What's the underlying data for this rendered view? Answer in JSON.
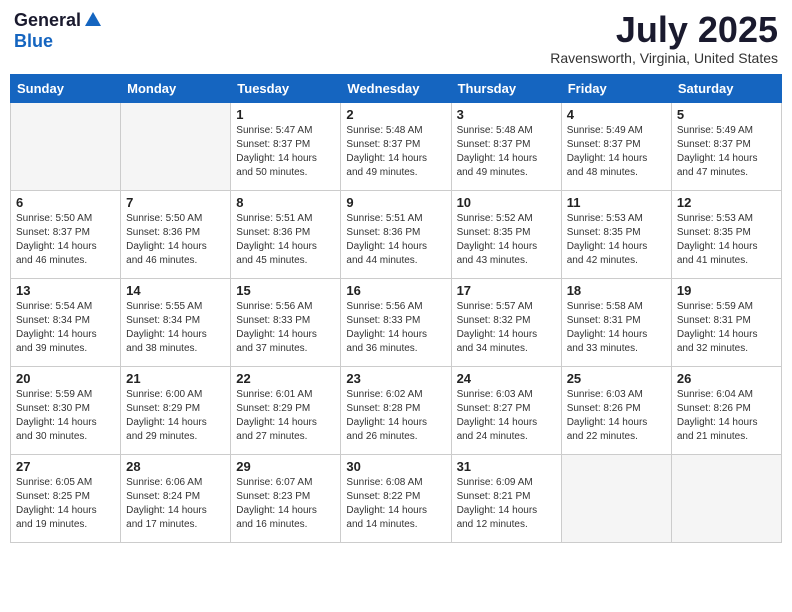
{
  "header": {
    "logo_line1": "General",
    "logo_line2": "Blue",
    "month_title": "July 2025",
    "location": "Ravensworth, Virginia, United States"
  },
  "weekdays": [
    "Sunday",
    "Monday",
    "Tuesday",
    "Wednesday",
    "Thursday",
    "Friday",
    "Saturday"
  ],
  "weeks": [
    [
      {
        "day": "",
        "empty": true
      },
      {
        "day": "",
        "empty": true
      },
      {
        "day": "1",
        "sunrise": "5:47 AM",
        "sunset": "8:37 PM",
        "daylight": "14 hours and 50 minutes."
      },
      {
        "day": "2",
        "sunrise": "5:48 AM",
        "sunset": "8:37 PM",
        "daylight": "14 hours and 49 minutes."
      },
      {
        "day": "3",
        "sunrise": "5:48 AM",
        "sunset": "8:37 PM",
        "daylight": "14 hours and 49 minutes."
      },
      {
        "day": "4",
        "sunrise": "5:49 AM",
        "sunset": "8:37 PM",
        "daylight": "14 hours and 48 minutes."
      },
      {
        "day": "5",
        "sunrise": "5:49 AM",
        "sunset": "8:37 PM",
        "daylight": "14 hours and 47 minutes."
      }
    ],
    [
      {
        "day": "6",
        "sunrise": "5:50 AM",
        "sunset": "8:37 PM",
        "daylight": "14 hours and 46 minutes."
      },
      {
        "day": "7",
        "sunrise": "5:50 AM",
        "sunset": "8:36 PM",
        "daylight": "14 hours and 46 minutes."
      },
      {
        "day": "8",
        "sunrise": "5:51 AM",
        "sunset": "8:36 PM",
        "daylight": "14 hours and 45 minutes."
      },
      {
        "day": "9",
        "sunrise": "5:51 AM",
        "sunset": "8:36 PM",
        "daylight": "14 hours and 44 minutes."
      },
      {
        "day": "10",
        "sunrise": "5:52 AM",
        "sunset": "8:35 PM",
        "daylight": "14 hours and 43 minutes."
      },
      {
        "day": "11",
        "sunrise": "5:53 AM",
        "sunset": "8:35 PM",
        "daylight": "14 hours and 42 minutes."
      },
      {
        "day": "12",
        "sunrise": "5:53 AM",
        "sunset": "8:35 PM",
        "daylight": "14 hours and 41 minutes."
      }
    ],
    [
      {
        "day": "13",
        "sunrise": "5:54 AM",
        "sunset": "8:34 PM",
        "daylight": "14 hours and 39 minutes."
      },
      {
        "day": "14",
        "sunrise": "5:55 AM",
        "sunset": "8:34 PM",
        "daylight": "14 hours and 38 minutes."
      },
      {
        "day": "15",
        "sunrise": "5:56 AM",
        "sunset": "8:33 PM",
        "daylight": "14 hours and 37 minutes."
      },
      {
        "day": "16",
        "sunrise": "5:56 AM",
        "sunset": "8:33 PM",
        "daylight": "14 hours and 36 minutes."
      },
      {
        "day": "17",
        "sunrise": "5:57 AM",
        "sunset": "8:32 PM",
        "daylight": "14 hours and 34 minutes."
      },
      {
        "day": "18",
        "sunrise": "5:58 AM",
        "sunset": "8:31 PM",
        "daylight": "14 hours and 33 minutes."
      },
      {
        "day": "19",
        "sunrise": "5:59 AM",
        "sunset": "8:31 PM",
        "daylight": "14 hours and 32 minutes."
      }
    ],
    [
      {
        "day": "20",
        "sunrise": "5:59 AM",
        "sunset": "8:30 PM",
        "daylight": "14 hours and 30 minutes."
      },
      {
        "day": "21",
        "sunrise": "6:00 AM",
        "sunset": "8:29 PM",
        "daylight": "14 hours and 29 minutes."
      },
      {
        "day": "22",
        "sunrise": "6:01 AM",
        "sunset": "8:29 PM",
        "daylight": "14 hours and 27 minutes."
      },
      {
        "day": "23",
        "sunrise": "6:02 AM",
        "sunset": "8:28 PM",
        "daylight": "14 hours and 26 minutes."
      },
      {
        "day": "24",
        "sunrise": "6:03 AM",
        "sunset": "8:27 PM",
        "daylight": "14 hours and 24 minutes."
      },
      {
        "day": "25",
        "sunrise": "6:03 AM",
        "sunset": "8:26 PM",
        "daylight": "14 hours and 22 minutes."
      },
      {
        "day": "26",
        "sunrise": "6:04 AM",
        "sunset": "8:26 PM",
        "daylight": "14 hours and 21 minutes."
      }
    ],
    [
      {
        "day": "27",
        "sunrise": "6:05 AM",
        "sunset": "8:25 PM",
        "daylight": "14 hours and 19 minutes."
      },
      {
        "day": "28",
        "sunrise": "6:06 AM",
        "sunset": "8:24 PM",
        "daylight": "14 hours and 17 minutes."
      },
      {
        "day": "29",
        "sunrise": "6:07 AM",
        "sunset": "8:23 PM",
        "daylight": "14 hours and 16 minutes."
      },
      {
        "day": "30",
        "sunrise": "6:08 AM",
        "sunset": "8:22 PM",
        "daylight": "14 hours and 14 minutes."
      },
      {
        "day": "31",
        "sunrise": "6:09 AM",
        "sunset": "8:21 PM",
        "daylight": "14 hours and 12 minutes."
      },
      {
        "day": "",
        "empty": true
      },
      {
        "day": "",
        "empty": true
      }
    ]
  ]
}
